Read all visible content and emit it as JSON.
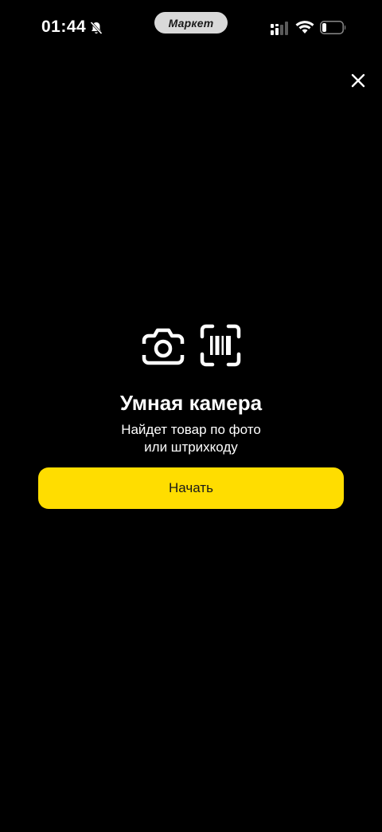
{
  "status_bar": {
    "time": "01:44",
    "bell_icon": "bell-slash-icon",
    "app_pill": "Маркет",
    "signal_icon": "cellular-signal-icon",
    "wifi_icon": "wifi-icon",
    "battery_icon": "battery-icon",
    "battery_level": 0.2
  },
  "header": {
    "close_icon": "close-icon"
  },
  "hero": {
    "camera_icon": "camera-icon",
    "barcode_icon": "barcode-scan-icon",
    "title": "Умная камера",
    "subtitle_line1": "Найдет товар по фото",
    "subtitle_line2": "или штрихкоду"
  },
  "actions": {
    "start_label": "Начать"
  },
  "colors": {
    "background": "#000000",
    "accent": "#ffdd00",
    "text": "#ffffff"
  }
}
